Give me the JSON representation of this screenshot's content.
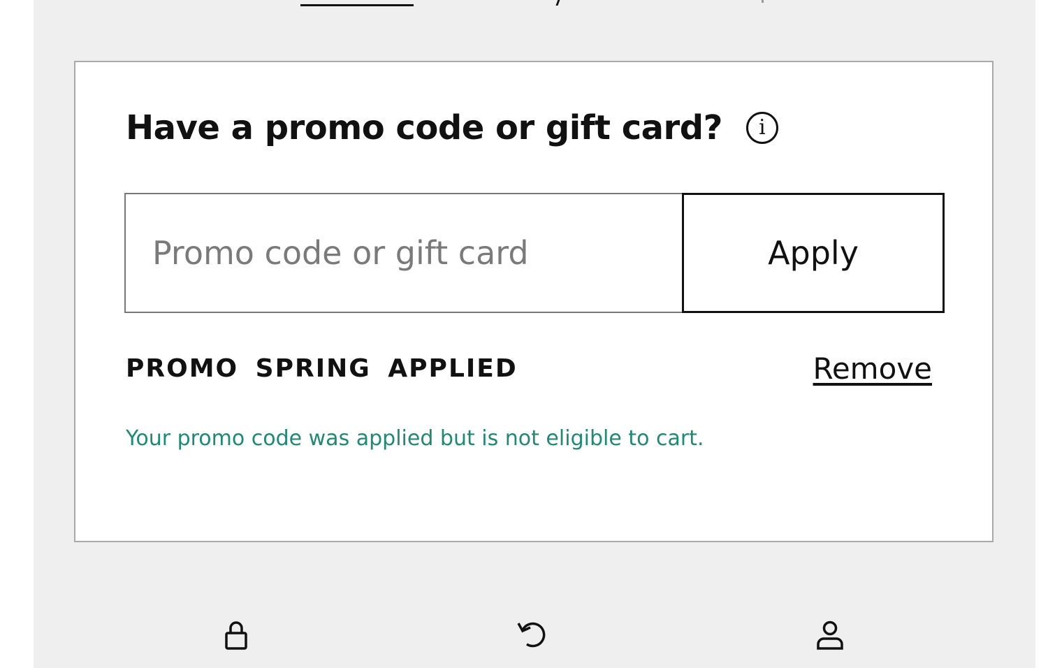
{
  "promo": {
    "heading": "Have a promo code or gift card?",
    "info_icon": "info-icon",
    "input_placeholder": "Promo code or gift card",
    "input_value": "",
    "apply_label": "Apply",
    "applied_label": "PROMO SPRING APPLIED",
    "remove_label": "Remove",
    "message": "Your promo code was applied but is not eligible to cart.",
    "message_color": "#1f8a73"
  },
  "footer_icons": [
    "lock-icon",
    "undo-icon",
    "user-icon"
  ]
}
